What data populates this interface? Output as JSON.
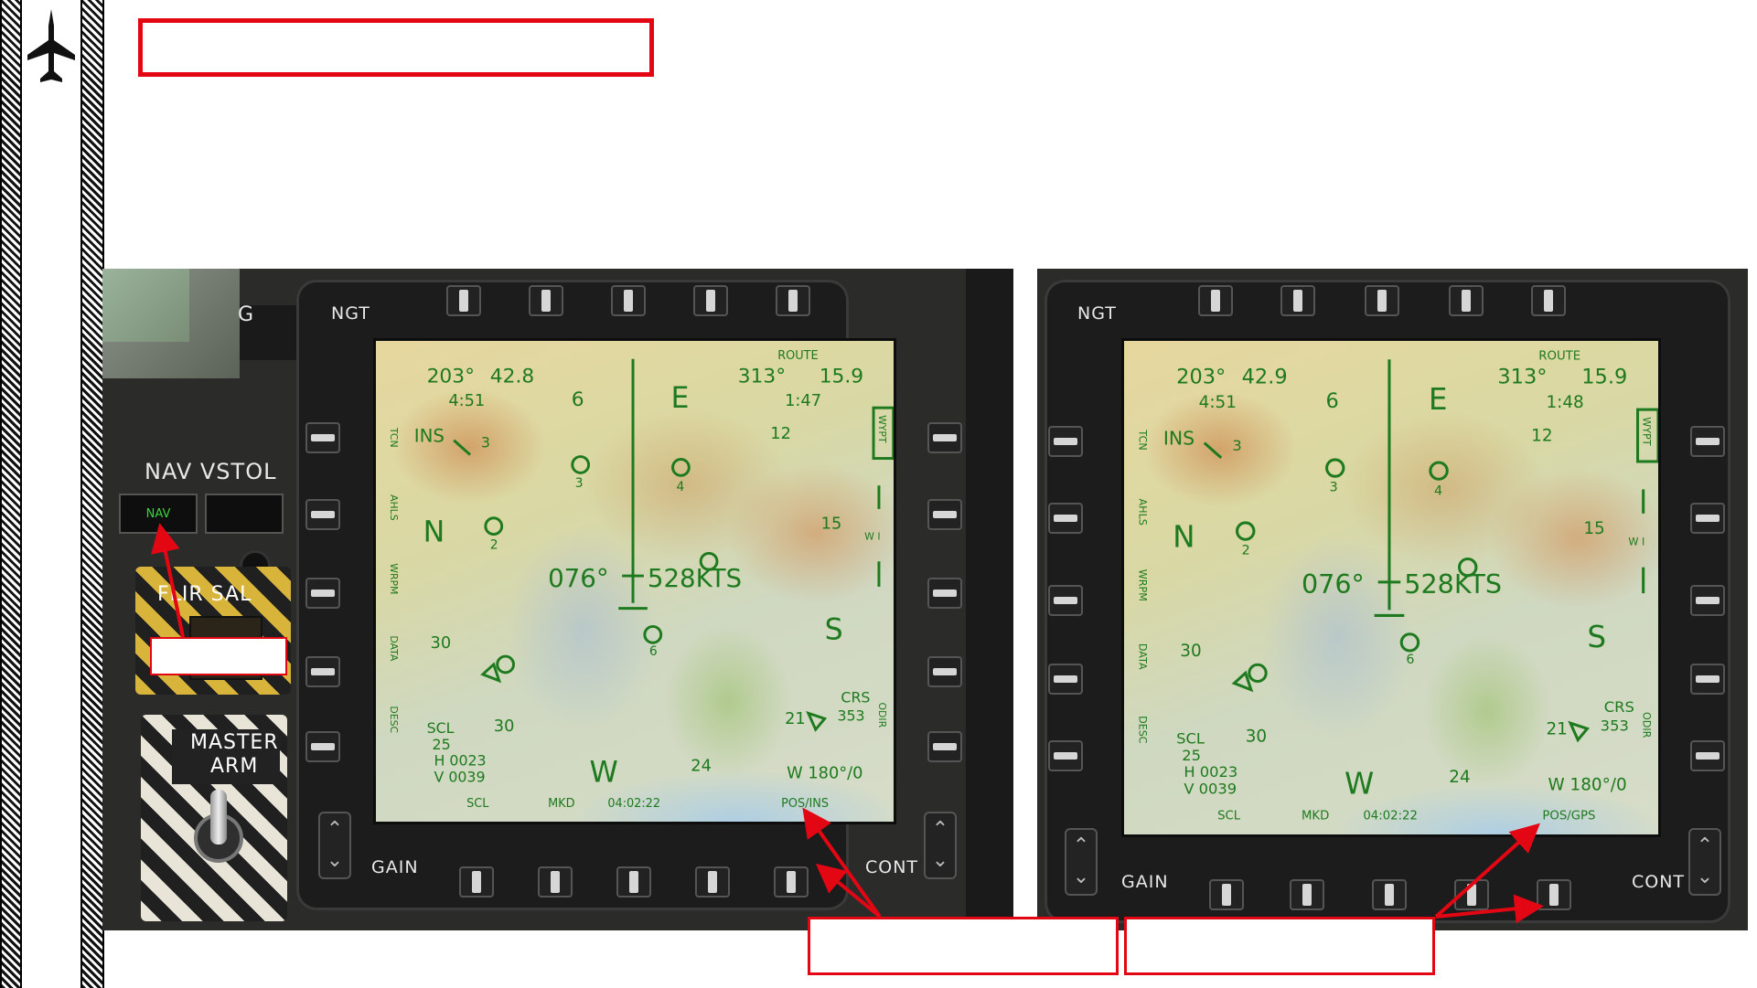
{
  "sidebar": {
    "icon": "aircraft-icon"
  },
  "colors": {
    "accent_red": "#e30613",
    "hud_green": "#1e7a1e",
    "nav_led": "#3fd13f"
  },
  "left_panel": {
    "ngt": "NGT",
    "gain": "GAIN",
    "cont": "CONT",
    "g_label": "G",
    "nav_vstol": "NAV VSTOL",
    "nav_button": "NAV",
    "flir_sal": "FLIR SAL",
    "master_arm": "MASTER",
    "master_arm2": "ARM"
  },
  "left_mfcd": {
    "hdg_left": "203°",
    "dist_left": "42.8",
    "time_left": "4:51",
    "num6": "6",
    "cardinal_e": "E",
    "brg_right": "313°",
    "dist_right": "15.9",
    "time_right": "1:47",
    "route": "ROUTE",
    "ins": "INS",
    "wp3": "3",
    "wp12": "12",
    "wp3b": "3",
    "wp4": "4",
    "wp15": "15",
    "cardinal_n": "N",
    "wp2": "2",
    "heading": "076°",
    "speed": "528KTS",
    "cardinal_s": "S",
    "wp6": "6",
    "num30a": "30",
    "num30b": "30",
    "crs": "CRS",
    "crs_val": "353",
    "num21": "21",
    "scl": "SCL",
    "scl_val": "25",
    "h": "H 0023",
    "v": "V 0039",
    "cardinal_w": "W",
    "num24": "24",
    "wind": "W 180°/0",
    "scl_btm": "SCL",
    "mkd": "MKD",
    "clock": "04:02:22",
    "pos": "POS/INS",
    "side_tcn": "TCN",
    "side_ahls": "AHLS",
    "side_wrpm": "WRPM",
    "side_data": "DATA",
    "side_desc": "DESC",
    "side_wypt": "WYPT",
    "side_wi": "W I",
    "side_odir": "ODIR"
  },
  "right_mfcd": {
    "hdg_left": "203°",
    "dist_left": "42.9",
    "time_left": "4:51",
    "num6": "6",
    "cardinal_e": "E",
    "brg_right": "313°",
    "dist_right": "15.9",
    "time_right": "1:48",
    "route": "ROUTE",
    "ins": "INS",
    "wp3": "3",
    "wp12": "12",
    "wp3b": "3",
    "wp4": "4",
    "wp15": "15",
    "cardinal_n": "N",
    "wp2": "2",
    "heading": "076°",
    "speed": "528KTS",
    "cardinal_s": "S",
    "wp6": "6",
    "num30a": "30",
    "num30b": "30",
    "crs": "CRS",
    "crs_val": "353",
    "num21": "21",
    "scl": "SCL",
    "scl_val": "25",
    "h": "H 0023",
    "v": "V 0039",
    "cardinal_w": "W",
    "num24": "24",
    "wind": "W 180°/0",
    "scl_btm": "SCL",
    "mkd": "MKD",
    "clock": "04:02:22",
    "pos": "POS/GPS",
    "side_tcn": "TCN",
    "side_ahls": "AHLS",
    "side_wrpm": "WRPM",
    "side_data": "DATA",
    "side_desc": "DESC",
    "side_wypt": "WYPT",
    "side_wi": "W I",
    "side_odir": "ODIR",
    "ngt": "NGT",
    "gain": "GAIN",
    "cont": "CONT"
  }
}
